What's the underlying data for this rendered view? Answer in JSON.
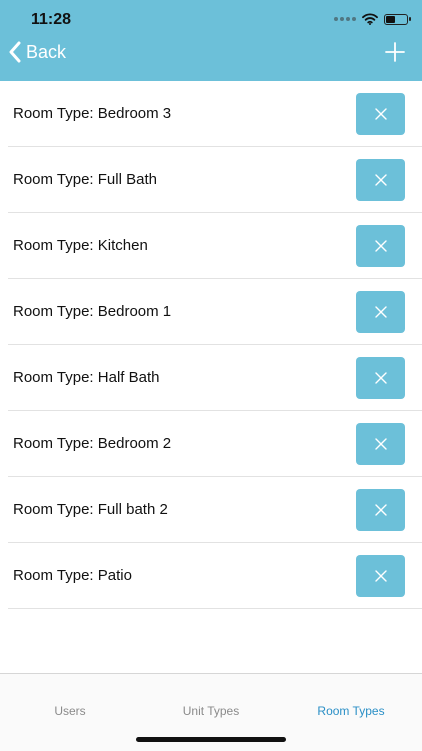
{
  "status_bar": {
    "time": "11:28",
    "icons": [
      "signal-dots-icon",
      "wifi-icon",
      "battery-icon"
    ]
  },
  "nav": {
    "back_label": "Back",
    "back_icon": "chevron-left-icon",
    "add_icon": "plus-icon"
  },
  "colors": {
    "accent": "#6cc0d9",
    "tab_active": "#2a8fc6",
    "tab_inactive": "#8a8a8a"
  },
  "rooms": [
    {
      "label": "Room Type: Bedroom 3"
    },
    {
      "label": "Room Type: Full Bath"
    },
    {
      "label": "Room Type: Kitchen"
    },
    {
      "label": "Room Type: Bedroom 1"
    },
    {
      "label": "Room Type: Half Bath"
    },
    {
      "label": "Room Type: Bedroom 2"
    },
    {
      "label": "Room Type: Full bath 2"
    },
    {
      "label": "Room Type: Patio"
    }
  ],
  "tabs": [
    {
      "label": "Users",
      "active": false
    },
    {
      "label": "Unit Types",
      "active": false
    },
    {
      "label": "Room Types",
      "active": true
    }
  ]
}
